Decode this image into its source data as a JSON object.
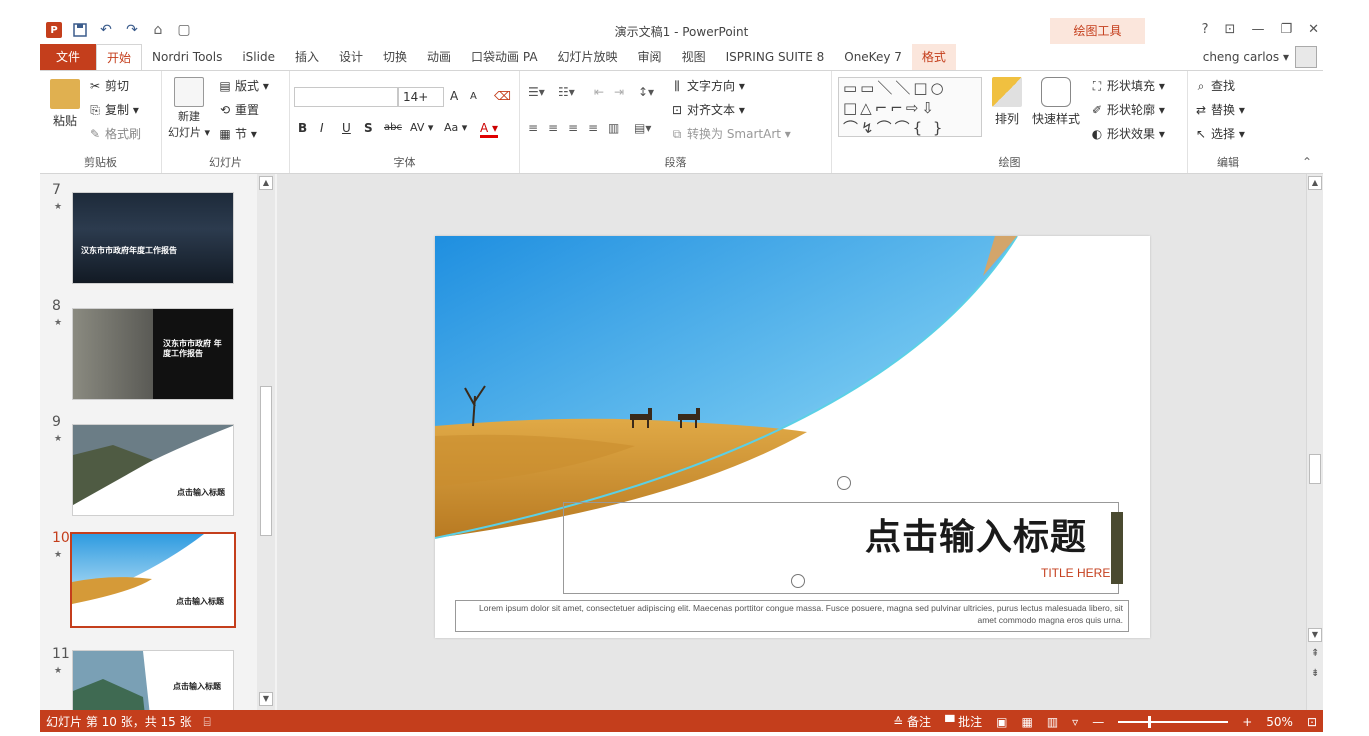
{
  "window": {
    "title": "演示文稿1 - PowerPoint",
    "context_tools_label": "绘图工具",
    "help": "?",
    "controls": [
      "⊡",
      "—",
      "❐",
      "✕"
    ]
  },
  "qat": {
    "app_icon": "P",
    "save_icon": "save-icon",
    "undo": "↶",
    "redo": "↷"
  },
  "tabs": [
    {
      "label": "文件",
      "kind": "file"
    },
    {
      "label": "开始",
      "kind": "active"
    },
    {
      "label": "Nordri Tools",
      "kind": ""
    },
    {
      "label": "iSlide",
      "kind": ""
    },
    {
      "label": "插入",
      "kind": ""
    },
    {
      "label": "设计",
      "kind": ""
    },
    {
      "label": "切换",
      "kind": ""
    },
    {
      "label": "动画",
      "kind": ""
    },
    {
      "label": "口袋动画 PA",
      "kind": ""
    },
    {
      "label": "幻灯片放映",
      "kind": ""
    },
    {
      "label": "审阅",
      "kind": ""
    },
    {
      "label": "视图",
      "kind": ""
    },
    {
      "label": "ISPRING SUITE 8",
      "kind": ""
    },
    {
      "label": "OneKey 7",
      "kind": ""
    },
    {
      "label": "格式",
      "kind": "ctx"
    }
  ],
  "user": {
    "name": "cheng carlos ▾"
  },
  "ribbon": {
    "clipboard": {
      "paste": "粘贴",
      "cut": "剪切",
      "copy": "复制 ▾",
      "format_painter": "格式刷",
      "label": "剪贴板"
    },
    "slides": {
      "new_slide_1": "新建",
      "new_slide_2": "幻灯片 ▾",
      "layout": "版式 ▾",
      "reset": "重置",
      "section": "节 ▾",
      "label": "幻灯片"
    },
    "font": {
      "font_name": "",
      "font_size": "14+",
      "bold": "B",
      "italic": "I",
      "underline": "U",
      "shadow": "S",
      "strike": "abc",
      "spacing": "AV ▾",
      "case": "Aa ▾",
      "color": "A ▾",
      "grow": "A",
      "shrink": "A",
      "label": "字体"
    },
    "paragraph": {
      "text_direction": "文字方向 ▾",
      "align_text": "对齐文本 ▾",
      "smartart": "转换为 SmartArt ▾",
      "label": "段落"
    },
    "drawing": {
      "arrange": "排列",
      "quick_styles": "快速样式",
      "fill": "形状填充 ▾",
      "outline": "形状轮廓 ▾",
      "effects": "形状效果 ▾",
      "label": "绘图"
    },
    "editing": {
      "find": "查找",
      "replace": "替换 ▾",
      "select": "选择 ▾",
      "label": "编辑"
    }
  },
  "thumbnails": [
    {
      "num": "7",
      "title": "汉东市市政府年度工作报告"
    },
    {
      "num": "8",
      "title": "汉东市市政府 年度工作报告"
    },
    {
      "num": "9",
      "title": "点击输入标题"
    },
    {
      "num": "10",
      "title": "点击输入标题"
    },
    {
      "num": "11",
      "title": "点击输入标题"
    }
  ],
  "slide": {
    "title": "点击输入标题",
    "subtitle": "TITLE HERE",
    "body": "Lorem ipsum dolor sit amet, consectetuer adipiscing elit. Maecenas porttitor congue massa. Fusce posuere, magna sed pulvinar ultricies, purus lectus malesuada libero, sit amet commodo magna eros quis urna."
  },
  "status": {
    "slide_info": "幻灯片 第 10 张，共 15 张",
    "notes": "备注",
    "comments": "批注",
    "zoom": "50%"
  },
  "colors": {
    "accent": "#c43e1c",
    "sky": "#3aa7e8",
    "sand": "#d9a23f"
  }
}
